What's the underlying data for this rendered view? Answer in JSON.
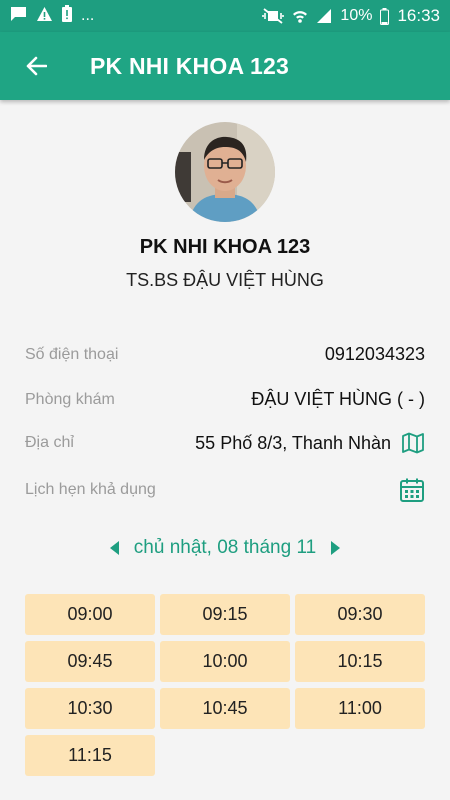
{
  "status_bar": {
    "left_icons": [
      "chat-icon",
      "warning-icon",
      "battery-alert-icon"
    ],
    "more": "...",
    "battery_percent": "10%",
    "time": "16:33"
  },
  "app_bar": {
    "title": "PK NHI KHOA 123",
    "back_icon": "arrow-back-icon"
  },
  "profile": {
    "clinic_name": "PK NHI KHOA 123",
    "doctor_name": "TS.BS ĐẬU VIỆT HÙNG"
  },
  "info": {
    "phone_label": "Số điện thoại",
    "phone_value": "0912034323",
    "clinic_label": "Phòng khám",
    "clinic_value": "ĐẬU VIỆT HÙNG ( - )",
    "address_label": "Địa chỉ",
    "address_value": "55 Phố 8/3, Thanh Nhàn",
    "schedule_label": "Lịch hẹn khả dụng"
  },
  "date_nav": {
    "date_text": "chủ nhật, 08 tháng 11"
  },
  "slots": [
    "09:00",
    "09:15",
    "09:30",
    "09:45",
    "10:00",
    "10:15",
    "10:30",
    "10:45",
    "11:00",
    "11:15"
  ],
  "colors": {
    "primary": "#1fa584",
    "slot_background": "#fde4b7",
    "label_gray": "#9b9b9b"
  }
}
